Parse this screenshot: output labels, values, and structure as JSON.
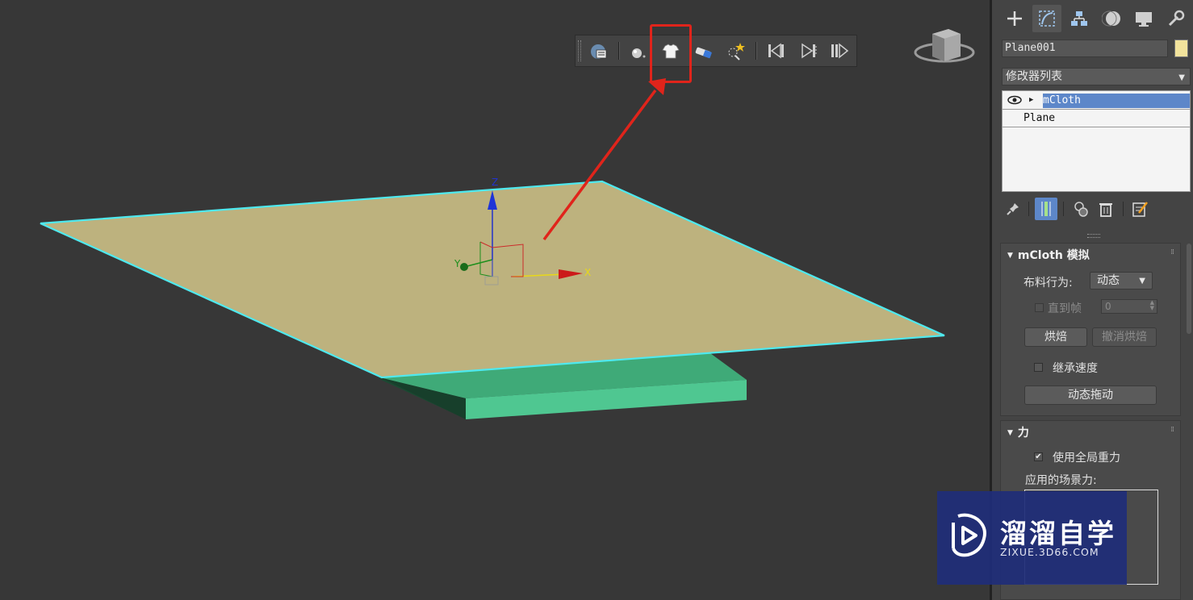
{
  "viewport": {
    "gizmo_axes": {
      "x": "X",
      "y": "Y",
      "z": "Z"
    }
  },
  "mcloth_toolbar": {
    "buttons": [
      "cloth-properties-icon",
      "sphere-icon",
      "cloth-tshirt-icon",
      "eraser-icon",
      "magic-select-icon",
      "rewind-icon",
      "play-icon",
      "step-icon"
    ]
  },
  "panel": {
    "tabs": [
      "create-icon",
      "modify-icon",
      "hierarchy-icon",
      "motion-icon",
      "display-icon",
      "utilities-icon"
    ],
    "object_name": "Plane001",
    "object_color": "#f2e39c",
    "modifier_list_label": "修改器列表",
    "stack": [
      {
        "label": "mCloth",
        "selected": true
      },
      {
        "label": "Plane",
        "selected": false
      }
    ],
    "mcloth_sim": {
      "title": "mCloth 模拟",
      "behavior_label": "布料行为:",
      "behavior_value": "动态",
      "until_frame_label": "直到帧",
      "until_frame_value": "0",
      "bake_label": "烘焙",
      "unbake_label": "撤消烘焙",
      "inherit_velocity_label": "继承速度",
      "dynamic_drag_label": "动态拖动"
    },
    "forces": {
      "title": "力",
      "use_global_gravity_label": "使用全局重力",
      "use_global_gravity_checked": true,
      "scene_forces_label": "应用的场景力:"
    }
  },
  "watermark": {
    "cn": "溜溜自学",
    "en": "ZIXUE.3D66.COM"
  },
  "colors": {
    "plane_top": "#bdb27e",
    "plane_edge": "#4ee9ef",
    "box_front": "#4fc791",
    "box_top": "#3faa78",
    "box_side": "#1a4a32",
    "annotation": "#e0241b",
    "selection": "#5d87c9"
  }
}
